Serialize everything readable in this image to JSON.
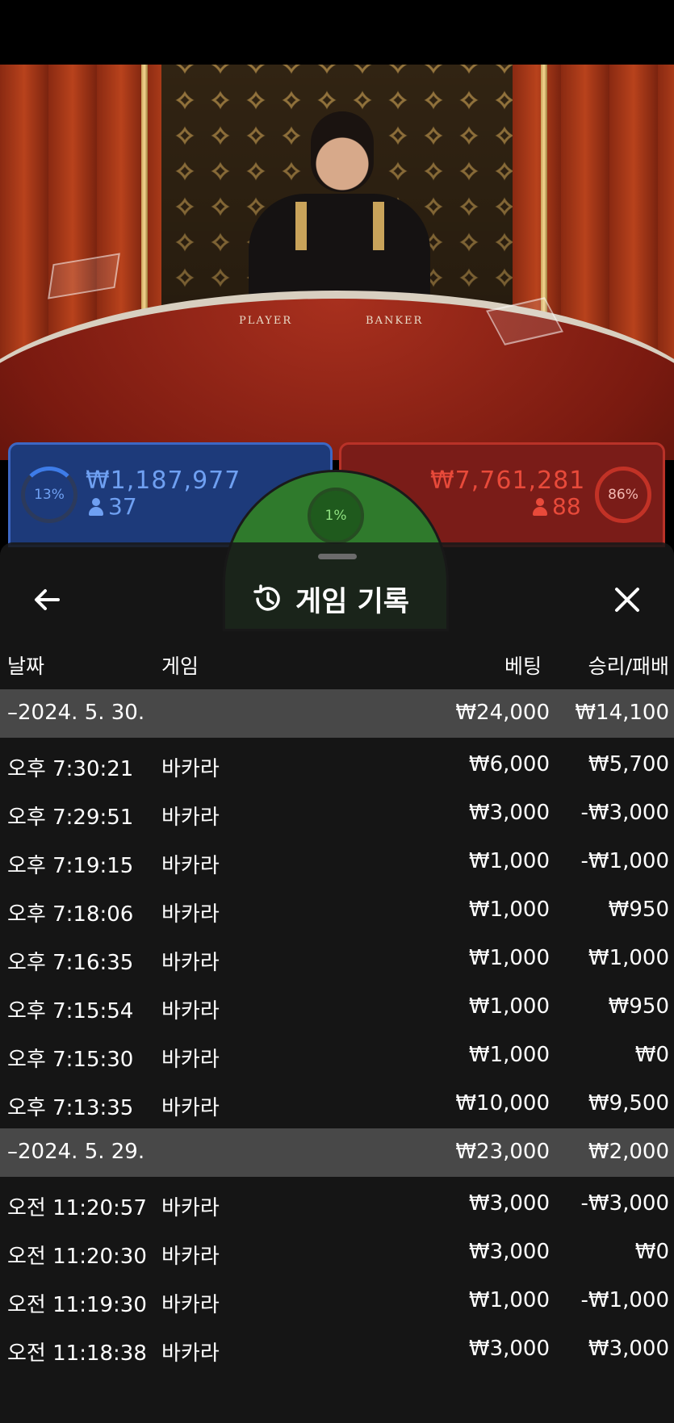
{
  "scene": {
    "table_labels": [
      "PLAYER",
      "BANKER"
    ]
  },
  "bets": {
    "player": {
      "percent": "13%",
      "amount": "₩1,187,977",
      "count": "37",
      "color": "#3e7ce8"
    },
    "tie": {
      "percent": "1%",
      "color": "#2f7a2c"
    },
    "banker": {
      "percent": "86%",
      "amount": "₩7,761,281",
      "count": "88",
      "color": "#c23226"
    }
  },
  "modal": {
    "title": "게임 기록",
    "back_icon": "arrow-left-icon",
    "history_icon": "history-icon",
    "close_icon": "close-icon",
    "columns": {
      "date": "날짜",
      "game": "게임",
      "bet": "베팅",
      "winloss": "승리/패배"
    },
    "groups": [
      {
        "date": "–2024. 5. 30.",
        "bet": "₩24,000",
        "winloss": "₩14,100",
        "rows": [
          {
            "time": "오후 7:30:21",
            "game": "바카라",
            "bet": "₩6,000",
            "winloss": "₩5,700"
          },
          {
            "time": "오후 7:29:51",
            "game": "바카라",
            "bet": "₩3,000",
            "winloss": "-₩3,000"
          },
          {
            "time": "오후 7:19:15",
            "game": "바카라",
            "bet": "₩1,000",
            "winloss": "-₩1,000"
          },
          {
            "time": "오후 7:18:06",
            "game": "바카라",
            "bet": "₩1,000",
            "winloss": "₩950"
          },
          {
            "time": "오후 7:16:35",
            "game": "바카라",
            "bet": "₩1,000",
            "winloss": "₩1,000"
          },
          {
            "time": "오후 7:15:54",
            "game": "바카라",
            "bet": "₩1,000",
            "winloss": "₩950"
          },
          {
            "time": "오후 7:15:30",
            "game": "바카라",
            "bet": "₩1,000",
            "winloss": "₩0"
          },
          {
            "time": "오후 7:13:35",
            "game": "바카라",
            "bet": "₩10,000",
            "winloss": "₩9,500"
          }
        ]
      },
      {
        "date": "–2024. 5. 29.",
        "bet": "₩23,000",
        "winloss": "₩2,000",
        "rows": [
          {
            "time": "오전 11:20:57",
            "game": "바카라",
            "bet": "₩3,000",
            "winloss": "-₩3,000"
          },
          {
            "time": "오전 11:20:30",
            "game": "바카라",
            "bet": "₩3,000",
            "winloss": "₩0"
          },
          {
            "time": "오전 11:19:30",
            "game": "바카라",
            "bet": "₩1,000",
            "winloss": "-₩1,000"
          },
          {
            "time": "오전 11:18:38",
            "game": "바카라",
            "bet": "₩3,000",
            "winloss": "₩3,000"
          }
        ]
      }
    ]
  }
}
